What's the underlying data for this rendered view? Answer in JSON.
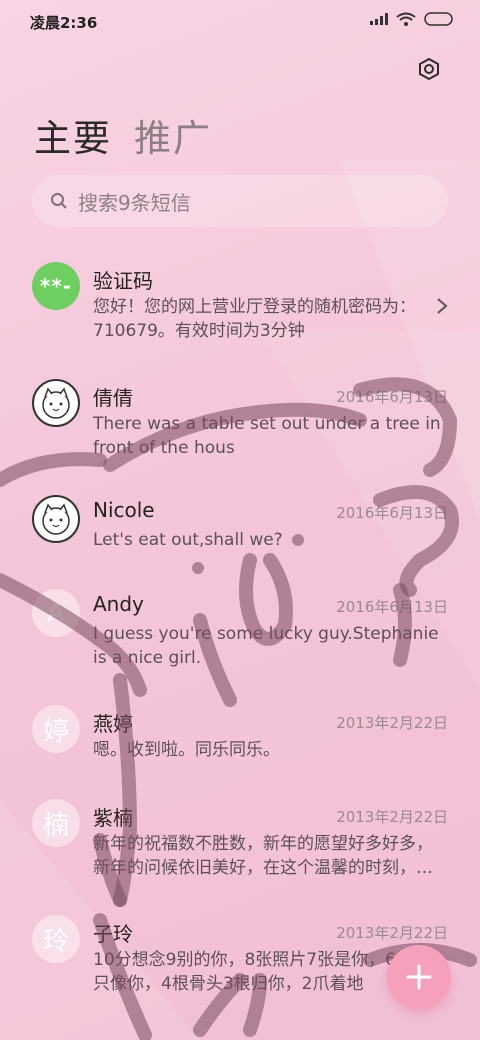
{
  "status_bar": {
    "time": "凌晨2:36"
  },
  "tabs": [
    {
      "label": "主要"
    },
    {
      "label": "推广"
    }
  ],
  "search": {
    "placeholder": "搜索9条短信"
  },
  "messages": [
    {
      "avatar_text": "**-",
      "name": "验证码",
      "date": "",
      "preview": "您好！您的网上营业厅登录的随机密码为：710679。有效时间为3分钟"
    },
    {
      "avatar_text": "",
      "name": "倩倩",
      "date": "2016年6月13日",
      "preview": "There was a table set out under a tree in front of the hous"
    },
    {
      "avatar_text": "",
      "name": "Nicole",
      "date": "2016年6月13日",
      "preview": "Let's eat out,shall we?"
    },
    {
      "avatar_text": "A",
      "name": "Andy",
      "date": "2016年6月13日",
      "preview": "I guess you're some lucky guy.Stephanie is a nice girl."
    },
    {
      "avatar_text": "婷",
      "name": "燕婷",
      "date": "2013年2月22日",
      "preview": "嗯。收到啦。同乐同乐。"
    },
    {
      "avatar_text": "楠",
      "name": "紫楠",
      "date": "2013年2月22日",
      "preview": "新年的祝福数不胜数，新年的愿望好多好多，新年的问候依旧美好，在这个温馨的时刻，…"
    },
    {
      "avatar_text": "玲",
      "name": "子玲",
      "date": "2013年2月22日",
      "preview": "10分想念9别的你，8张照片7张是你，6…狗5只像你，4根骨头3根归你，2爪着地"
    }
  ],
  "icons": {
    "settings": "settings-icon",
    "search": "search-icon",
    "compose": "plus-icon"
  },
  "colors": {
    "accent": "#f6a0bd",
    "verify_avatar": "#6ccf5f"
  }
}
